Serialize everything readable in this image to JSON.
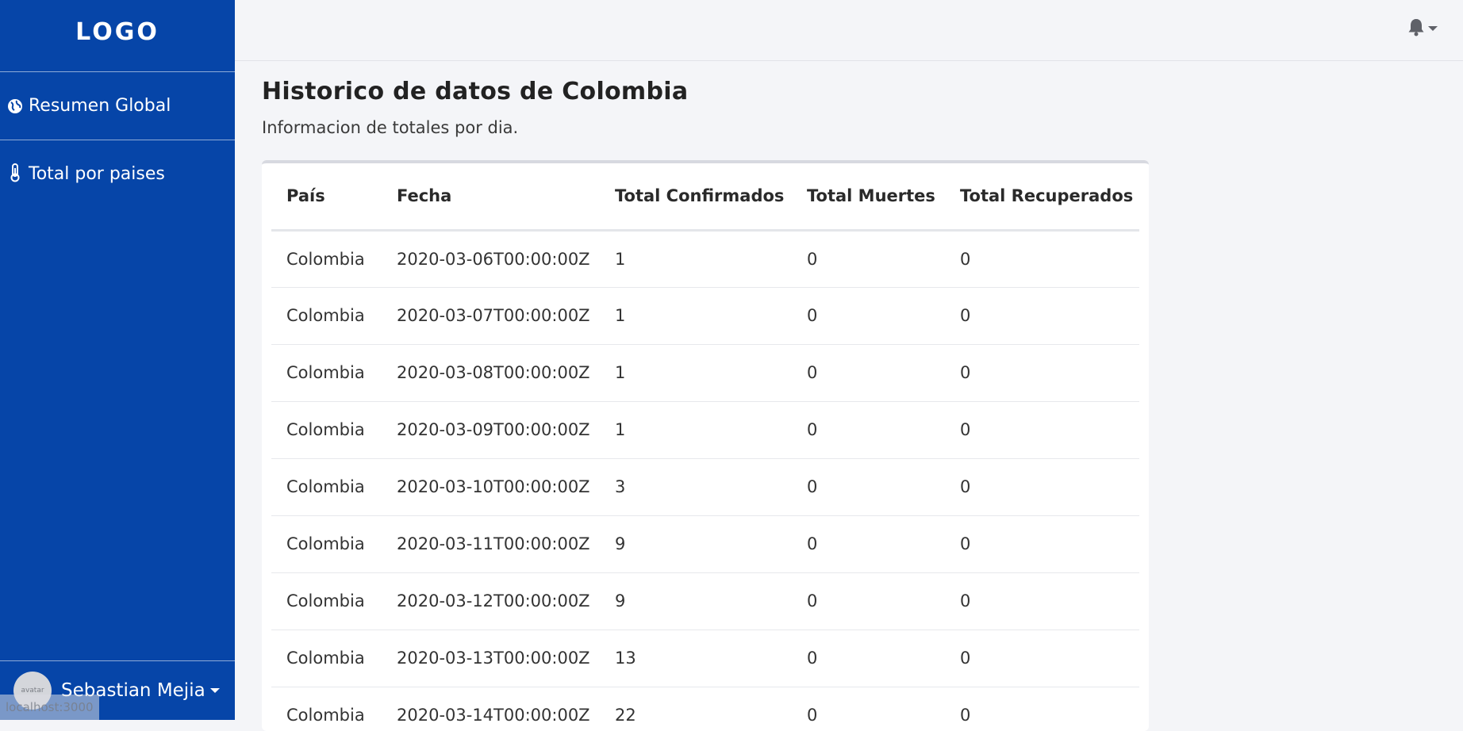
{
  "sidebar": {
    "logo": "LOGO",
    "items": [
      {
        "label": "Resumen Global",
        "icon": "globe-icon"
      },
      {
        "label": "Total por paises",
        "icon": "thermometer-icon"
      }
    ],
    "user": {
      "name": "Sebastian Mejia",
      "avatar_text": "avatar"
    }
  },
  "status_bar": {
    "url": "localhost:3000"
  },
  "topbar": {
    "notifications_icon": "bell-icon"
  },
  "main": {
    "title": "Historico de datos de Colombia",
    "subtitle": "Informacion de totales por dia."
  },
  "table": {
    "headers": [
      "País",
      "Fecha",
      "Total Confirmados",
      "Total Muertes",
      "Total Recuperados"
    ],
    "rows": [
      [
        "Colombia",
        "2020-03-06T00:00:00Z",
        "1",
        "0",
        "0"
      ],
      [
        "Colombia",
        "2020-03-07T00:00:00Z",
        "1",
        "0",
        "0"
      ],
      [
        "Colombia",
        "2020-03-08T00:00:00Z",
        "1",
        "0",
        "0"
      ],
      [
        "Colombia",
        "2020-03-09T00:00:00Z",
        "1",
        "0",
        "0"
      ],
      [
        "Colombia",
        "2020-03-10T00:00:00Z",
        "3",
        "0",
        "0"
      ],
      [
        "Colombia",
        "2020-03-11T00:00:00Z",
        "9",
        "0",
        "0"
      ],
      [
        "Colombia",
        "2020-03-12T00:00:00Z",
        "9",
        "0",
        "0"
      ],
      [
        "Colombia",
        "2020-03-13T00:00:00Z",
        "13",
        "0",
        "0"
      ],
      [
        "Colombia",
        "2020-03-14T00:00:00Z",
        "22",
        "0",
        "0"
      ]
    ]
  },
  "colors": {
    "sidebar_bg": "#0645a8",
    "page_bg": "#f4f5f8",
    "card_bg": "#ffffff"
  }
}
